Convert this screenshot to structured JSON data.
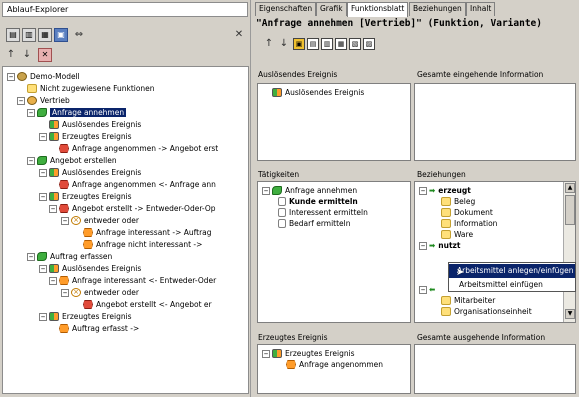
{
  "left": {
    "title": "Ablauf-Explorer",
    "close_glyph": "✕",
    "arrow_up": "↑",
    "arrow_down": "↓",
    "toolbar_link": "⇔"
  },
  "tree": {
    "root": "Demo-Modell",
    "unassigned": "Nicht zugewiesene Funktionen",
    "sales": "Vertrieb",
    "f1": "Anfrage annehmen",
    "f1_trigger": "Auslösendes Ereignis",
    "f1_created": "Erzeugtes Ereignis",
    "f1_created_item": "Anfrage angenommen -> Angebot erst",
    "f2": "Angebot erstellen",
    "f2_trigger": "Auslösendes Ereignis",
    "f2_trigger_item": "Anfrage angenommen <- Anfrage ann",
    "f2_created": "Erzeugtes Ereignis",
    "f2_created_item": "Angebot erstellt -> Entweder-Oder-Op",
    "xor1": "entweder oder",
    "xor1_a": "Anfrage interessant -> Auftrag",
    "xor1_b": "Anfrage nicht interessant ->",
    "f3": "Auftrag erfassen",
    "f3_trigger": "Auslösendes Ereignis",
    "f3_trigger_item": "Anfrage interessant <- Entweder-Oder",
    "xor2": "entweder oder",
    "xor2_item": "Angebot erstellt <- Angebot er",
    "f3_created": "Erzeugtes Ereignis",
    "f3_created_item": "Auftrag erfasst ->"
  },
  "tabs": [
    "Eigenschaften",
    "Grafik",
    "Funktionsblatt",
    "Beziehungen",
    "Inhalt"
  ],
  "heading": "\"Anfrage annehmen [Vertrieb]\" (Funktion, Variante)",
  "panels": {
    "trigger_label": "Auslösendes Ereignis",
    "trigger_item": "Auslösendes Ereignis",
    "incoming_label": "Gesamte eingehende Information",
    "activities_label": "Tätigkeiten",
    "act_root": "Anfrage annehmen",
    "act1": "Kunde ermitteln",
    "act2": "Interessent ermitteln",
    "act3": "Bedarf ermitteln",
    "relations_label": "Beziehungen",
    "rel_creates": "erzeugt",
    "rel_c1": "Beleg",
    "rel_c2": "Dokument",
    "rel_c3": "Information",
    "rel_c4": "Ware",
    "rel_uses": "nutzt",
    "rel_u1": "Mitarbeiter",
    "rel_u2": "Organisationseinheit",
    "created_label": "Erzeugtes Ereignis",
    "created_root": "Erzeugtes Ereignis",
    "created_item": "Anfrage angenommen",
    "outgoing_label": "Gesamte ausgehende Information"
  },
  "context_menu": {
    "item1": "Arbeitsmittel anlegen/einfügen",
    "item2": "Arbeitsmittel einfügen"
  }
}
